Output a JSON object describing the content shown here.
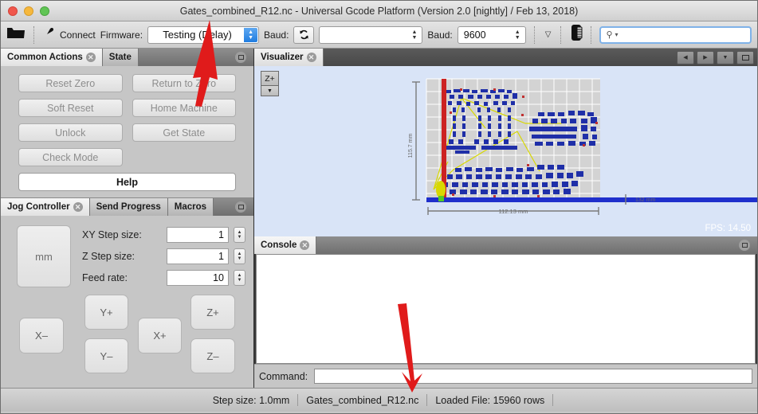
{
  "window": {
    "title": "Gates_combined_R12.nc - Universal Gcode Platform (Version 2.0 [nightly]  / Feb 13, 2018)",
    "close_label": "close-window",
    "minimize_label": "minimize-window",
    "maximize_label": "maximize-window"
  },
  "toolbar": {
    "open_icon": "folder-open-icon",
    "connect_icon": "plug-icon",
    "connect_label": "Connect",
    "firmware_label": "Firmware:",
    "firmware_value": "Testing (Delay)",
    "refresh_icon": "refresh-icon",
    "port_label": "Baud:",
    "port_value": "",
    "baud_label": "Baud:",
    "baud_value": "9600",
    "overflow_icon": "chevron-double-down-icon",
    "phone_icon": "mobile-device-icon",
    "search_icon": "search-icon",
    "search_chevron": "chevron-down-icon",
    "search_value": "",
    "search_placeholder": ""
  },
  "left_panel": {
    "tabs": [
      {
        "label": "Common Actions",
        "active": true,
        "closable": true
      },
      {
        "label": "State",
        "active": false,
        "closable": false
      }
    ],
    "maximize_icon": "maximize-panel-icon",
    "buttons": [
      "Reset Zero",
      "Return to Zero",
      "Soft Reset",
      "Home Machine",
      "Unlock",
      "Get State",
      "Check Mode"
    ],
    "help_label": "Help"
  },
  "jog_panel": {
    "tabs": [
      {
        "label": "Jog Controller",
        "active": true,
        "closable": true
      },
      {
        "label": "Send Progress",
        "active": false,
        "closable": false
      },
      {
        "label": "Macros",
        "active": false,
        "closable": false
      }
    ],
    "maximize_icon": "maximize-panel-icon",
    "units_label": "mm",
    "fields": [
      {
        "label": "XY Step size:",
        "value": "1"
      },
      {
        "label": "Z Step size:",
        "value": "1"
      },
      {
        "label": "Feed rate:",
        "value": "10"
      }
    ],
    "jog_buttons": {
      "x_minus": "X–",
      "x_plus": "X+",
      "y_plus": "Y+",
      "y_minus": "Y–",
      "z_plus": "Z+",
      "z_minus": "Z–"
    }
  },
  "visualizer": {
    "tabs": [
      {
        "label": "Visualizer",
        "active": true,
        "closable": true
      }
    ],
    "nav_back_icon": "arrow-left-icon",
    "nav_forward_icon": "arrow-right-icon",
    "nav_dropdown_icon": "chevron-down-icon",
    "maximize_icon": "maximize-panel-icon",
    "zplus_label": "Z+",
    "zplus_dropdown_icon": "chevron-down-icon",
    "fps_label": "FPS: 14.50",
    "width_dimension": "112.13 mm",
    "height_dimension": "115.7 mm",
    "colors": {
      "background": "#d9e4f7",
      "grid": "#c9c9c9",
      "toolpath": "#1f2fa8",
      "rapid": "#d4d400",
      "y_axis": "#cc2222",
      "x_axis": "#1f2fcc",
      "tool_marker": "#55cc22"
    }
  },
  "console_panel": {
    "tabs": [
      {
        "label": "Console",
        "active": true,
        "closable": true
      }
    ],
    "maximize_icon": "maximize-panel-icon",
    "content": "",
    "command_label": "Command:",
    "command_value": "",
    "command_placeholder": ""
  },
  "statusbar": {
    "step_size": "Step size: 1.0mm",
    "file_name": "Gates_combined_R12.nc",
    "loaded_file": "Loaded File: 15960 rows"
  },
  "annotations": {
    "arrow_color": "#e01b1b",
    "arrow1_target": "firmware-dropdown",
    "arrow2_target": "command-input"
  }
}
